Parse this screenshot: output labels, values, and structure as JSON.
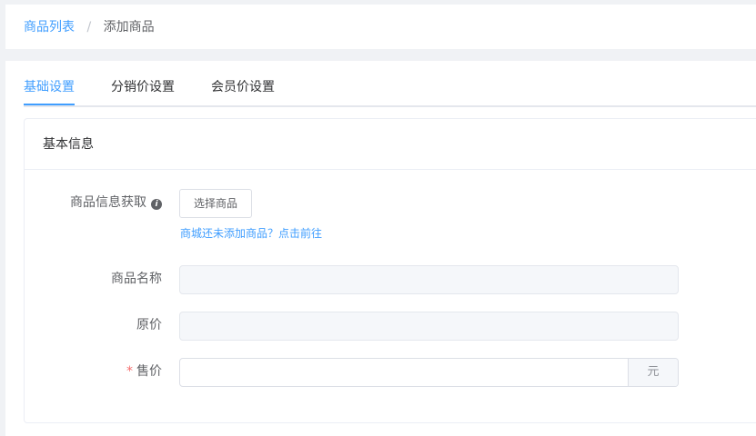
{
  "breadcrumb": {
    "parent": "商品列表",
    "separator": "/",
    "current": "添加商品"
  },
  "tabs": [
    {
      "label": "基础设置",
      "active": true
    },
    {
      "label": "分销价设置",
      "active": false
    },
    {
      "label": "会员价设置",
      "active": false
    }
  ],
  "card": {
    "title": "基本信息"
  },
  "form": {
    "product_info_label": "商品信息获取",
    "info_icon": "info-icon",
    "select_button": "选择商品",
    "hint_link": "商城还未添加商品？点击前往",
    "name_label": "商品名称",
    "name_value": "",
    "original_price_label": "原价",
    "original_price_value": "",
    "price_required_mark": "*",
    "price_label": "售价",
    "price_value": "",
    "price_unit": "元"
  },
  "colors": {
    "accent": "#409eff",
    "required": "#f56c6c",
    "disabled_bg": "#f5f7fa"
  }
}
